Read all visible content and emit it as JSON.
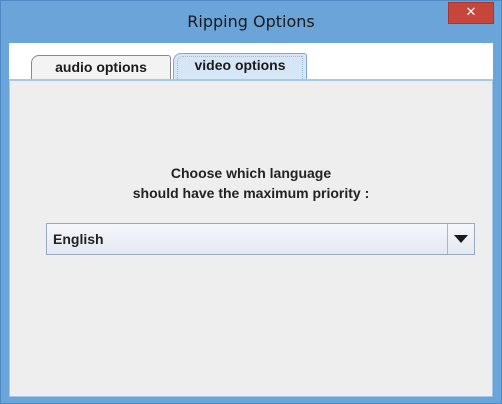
{
  "window": {
    "title": "Ripping Options",
    "close_label": "✕"
  },
  "tabs": [
    {
      "label": "audio options",
      "selected": false
    },
    {
      "label": "video options",
      "selected": true
    }
  ],
  "video_panel": {
    "prompt_line1": "Choose which language",
    "prompt_line2": "should have the maximum priority :",
    "language_select": {
      "value": "English",
      "icon": "chevron-down-icon"
    }
  },
  "colors": {
    "frame": "#6aa4d9",
    "close_button": "#c7463c",
    "selected_tab": "#d6e6f6",
    "panel_background": "#eeeeee"
  }
}
